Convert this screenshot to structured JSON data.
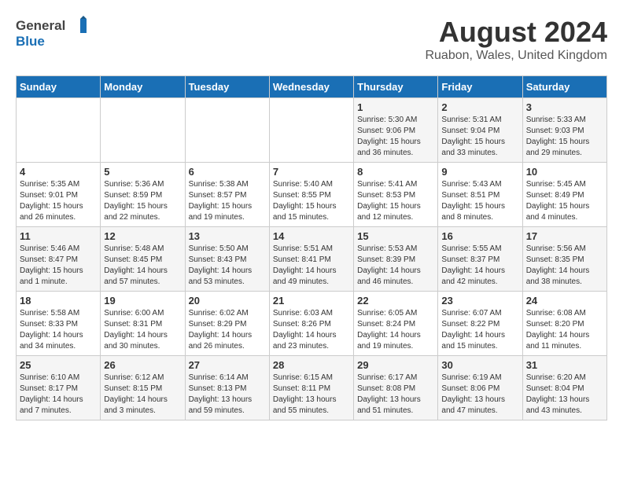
{
  "header": {
    "logo_general": "General",
    "logo_blue": "Blue",
    "main_title": "August 2024",
    "subtitle": "Ruabon, Wales, United Kingdom"
  },
  "weekdays": [
    "Sunday",
    "Monday",
    "Tuesday",
    "Wednesday",
    "Thursday",
    "Friday",
    "Saturday"
  ],
  "weeks": [
    [
      {
        "day": "",
        "info": ""
      },
      {
        "day": "",
        "info": ""
      },
      {
        "day": "",
        "info": ""
      },
      {
        "day": "",
        "info": ""
      },
      {
        "day": "1",
        "info": "Sunrise: 5:30 AM\nSunset: 9:06 PM\nDaylight: 15 hours\nand 36 minutes."
      },
      {
        "day": "2",
        "info": "Sunrise: 5:31 AM\nSunset: 9:04 PM\nDaylight: 15 hours\nand 33 minutes."
      },
      {
        "day": "3",
        "info": "Sunrise: 5:33 AM\nSunset: 9:03 PM\nDaylight: 15 hours\nand 29 minutes."
      }
    ],
    [
      {
        "day": "4",
        "info": "Sunrise: 5:35 AM\nSunset: 9:01 PM\nDaylight: 15 hours\nand 26 minutes."
      },
      {
        "day": "5",
        "info": "Sunrise: 5:36 AM\nSunset: 8:59 PM\nDaylight: 15 hours\nand 22 minutes."
      },
      {
        "day": "6",
        "info": "Sunrise: 5:38 AM\nSunset: 8:57 PM\nDaylight: 15 hours\nand 19 minutes."
      },
      {
        "day": "7",
        "info": "Sunrise: 5:40 AM\nSunset: 8:55 PM\nDaylight: 15 hours\nand 15 minutes."
      },
      {
        "day": "8",
        "info": "Sunrise: 5:41 AM\nSunset: 8:53 PM\nDaylight: 15 hours\nand 12 minutes."
      },
      {
        "day": "9",
        "info": "Sunrise: 5:43 AM\nSunset: 8:51 PM\nDaylight: 15 hours\nand 8 minutes."
      },
      {
        "day": "10",
        "info": "Sunrise: 5:45 AM\nSunset: 8:49 PM\nDaylight: 15 hours\nand 4 minutes."
      }
    ],
    [
      {
        "day": "11",
        "info": "Sunrise: 5:46 AM\nSunset: 8:47 PM\nDaylight: 15 hours\nand 1 minute."
      },
      {
        "day": "12",
        "info": "Sunrise: 5:48 AM\nSunset: 8:45 PM\nDaylight: 14 hours\nand 57 minutes."
      },
      {
        "day": "13",
        "info": "Sunrise: 5:50 AM\nSunset: 8:43 PM\nDaylight: 14 hours\nand 53 minutes."
      },
      {
        "day": "14",
        "info": "Sunrise: 5:51 AM\nSunset: 8:41 PM\nDaylight: 14 hours\nand 49 minutes."
      },
      {
        "day": "15",
        "info": "Sunrise: 5:53 AM\nSunset: 8:39 PM\nDaylight: 14 hours\nand 46 minutes."
      },
      {
        "day": "16",
        "info": "Sunrise: 5:55 AM\nSunset: 8:37 PM\nDaylight: 14 hours\nand 42 minutes."
      },
      {
        "day": "17",
        "info": "Sunrise: 5:56 AM\nSunset: 8:35 PM\nDaylight: 14 hours\nand 38 minutes."
      }
    ],
    [
      {
        "day": "18",
        "info": "Sunrise: 5:58 AM\nSunset: 8:33 PM\nDaylight: 14 hours\nand 34 minutes."
      },
      {
        "day": "19",
        "info": "Sunrise: 6:00 AM\nSunset: 8:31 PM\nDaylight: 14 hours\nand 30 minutes."
      },
      {
        "day": "20",
        "info": "Sunrise: 6:02 AM\nSunset: 8:29 PM\nDaylight: 14 hours\nand 26 minutes."
      },
      {
        "day": "21",
        "info": "Sunrise: 6:03 AM\nSunset: 8:26 PM\nDaylight: 14 hours\nand 23 minutes."
      },
      {
        "day": "22",
        "info": "Sunrise: 6:05 AM\nSunset: 8:24 PM\nDaylight: 14 hours\nand 19 minutes."
      },
      {
        "day": "23",
        "info": "Sunrise: 6:07 AM\nSunset: 8:22 PM\nDaylight: 14 hours\nand 15 minutes."
      },
      {
        "day": "24",
        "info": "Sunrise: 6:08 AM\nSunset: 8:20 PM\nDaylight: 14 hours\nand 11 minutes."
      }
    ],
    [
      {
        "day": "25",
        "info": "Sunrise: 6:10 AM\nSunset: 8:17 PM\nDaylight: 14 hours\nand 7 minutes."
      },
      {
        "day": "26",
        "info": "Sunrise: 6:12 AM\nSunset: 8:15 PM\nDaylight: 14 hours\nand 3 minutes."
      },
      {
        "day": "27",
        "info": "Sunrise: 6:14 AM\nSunset: 8:13 PM\nDaylight: 13 hours\nand 59 minutes."
      },
      {
        "day": "28",
        "info": "Sunrise: 6:15 AM\nSunset: 8:11 PM\nDaylight: 13 hours\nand 55 minutes."
      },
      {
        "day": "29",
        "info": "Sunrise: 6:17 AM\nSunset: 8:08 PM\nDaylight: 13 hours\nand 51 minutes."
      },
      {
        "day": "30",
        "info": "Sunrise: 6:19 AM\nSunset: 8:06 PM\nDaylight: 13 hours\nand 47 minutes."
      },
      {
        "day": "31",
        "info": "Sunrise: 6:20 AM\nSunset: 8:04 PM\nDaylight: 13 hours\nand 43 minutes."
      }
    ]
  ]
}
